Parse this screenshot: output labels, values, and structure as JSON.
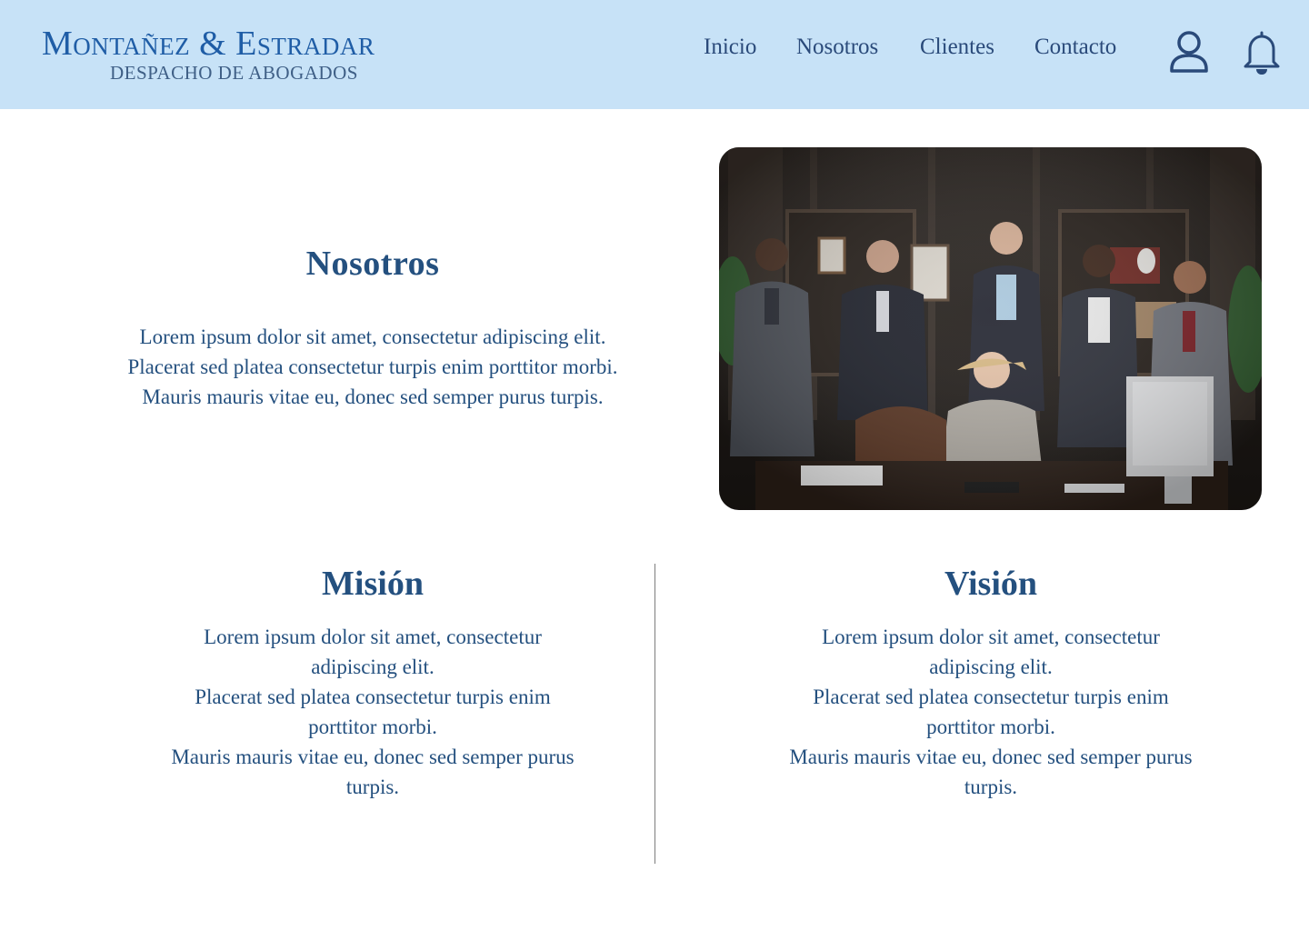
{
  "header": {
    "logo_main": "Montañez & Estradar",
    "logo_sub": "DESPACHO DE ABOGADOS",
    "nav": [
      {
        "label": "Inicio"
      },
      {
        "label": "Nosotros"
      },
      {
        "label": "Clientes"
      },
      {
        "label": "Contacto"
      }
    ],
    "icons": [
      "user-icon",
      "bell-icon"
    ]
  },
  "about": {
    "title": "Nosotros",
    "lines": [
      "Lorem ipsum dolor sit amet, consectetur adipiscing elit.",
      "Placerat sed platea consectetur turpis enim porttitor morbi.",
      "Mauris mauris vitae eu, donec sed semper purus turpis."
    ]
  },
  "mision": {
    "title": "Misión",
    "lines": [
      "Lorem ipsum dolor sit amet, consectetur",
      "adipiscing elit.",
      "Placerat sed platea consectetur turpis enim",
      "porttitor morbi.",
      "Mauris mauris vitae eu, donec sed semper purus",
      "turpis."
    ]
  },
  "vision": {
    "title": "Visión",
    "lines": [
      "Lorem ipsum dolor sit amet, consectetur",
      "adipiscing elit.",
      "Placerat sed platea consectetur turpis enim",
      "porttitor morbi.",
      "Mauris mauris vitae eu, donec sed semper purus",
      "turpis."
    ]
  },
  "colors": {
    "header_bg": "#c7e2f7",
    "logo": "#1f5da6",
    "text": "#24507f",
    "divider": "#7d7d7d"
  }
}
